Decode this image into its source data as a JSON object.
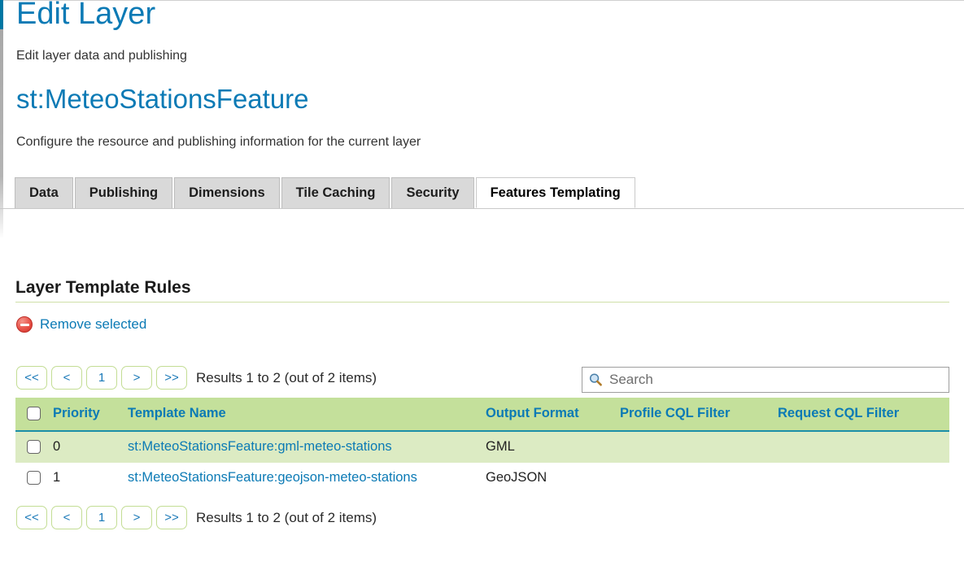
{
  "header": {
    "page_title": "Edit Layer",
    "page_subtitle": "Edit layer data and publishing",
    "resource_title": "st:MeteoStationsFeature",
    "resource_subtitle": "Configure the resource and publishing information for the current layer"
  },
  "tabs": [
    {
      "label": "Data",
      "active": false
    },
    {
      "label": "Publishing",
      "active": false
    },
    {
      "label": "Dimensions",
      "active": false
    },
    {
      "label": "Tile Caching",
      "active": false
    },
    {
      "label": "Security",
      "active": false
    },
    {
      "label": "Features Templating",
      "active": true
    }
  ],
  "section": {
    "title": "Layer Template Rules",
    "remove_selected_label": "Remove selected",
    "remove_icon": "remove-circle-icon"
  },
  "search": {
    "placeholder": "Search",
    "value": "",
    "icon": "search-icon"
  },
  "pagination": {
    "first_label": "<<",
    "prev_label": "<",
    "page_label": "1",
    "next_label": ">",
    "last_label": ">>",
    "results_text": "Results 1 to 2 (out of 2 items)"
  },
  "table": {
    "columns": [
      {
        "key": "select",
        "label": ""
      },
      {
        "key": "priority",
        "label": "Priority"
      },
      {
        "key": "name",
        "label": "Template Name"
      },
      {
        "key": "format",
        "label": "Output Format"
      },
      {
        "key": "profile",
        "label": "Profile CQL Filter"
      },
      {
        "key": "request",
        "label": "Request CQL Filter"
      }
    ],
    "rows": [
      {
        "priority": "0",
        "name": "st:MeteoStationsFeature:gml-meteo-stations",
        "format": "GML",
        "profile": "",
        "request": "",
        "selected": false
      },
      {
        "priority": "1",
        "name": "st:MeteoStationsFeature:geojson-meteo-stations",
        "format": "GeoJSON",
        "profile": "",
        "request": "",
        "selected": false
      }
    ]
  },
  "colors": {
    "link": "#0b7ab5",
    "header_row": "#c4e09b",
    "odd_row": "#dcebc3",
    "accent_rail": "#0076a3",
    "pager_border": "#c3dd94",
    "header_underline": "#1c8fa8"
  }
}
